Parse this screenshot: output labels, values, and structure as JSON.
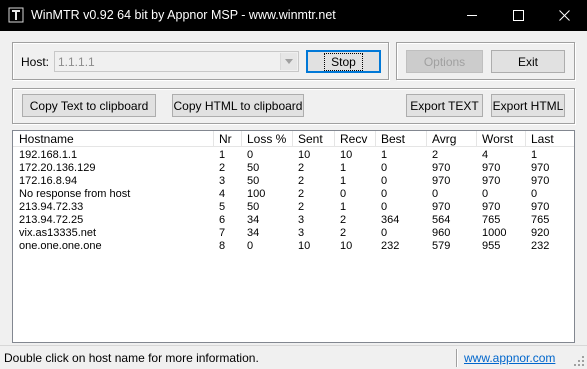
{
  "window": {
    "title": "WinMTR v0.92 64 bit by Appnor MSP - www.winmtr.net",
    "icon": "winmtr-app-icon",
    "controls": {
      "minimize": "minimize-icon",
      "maximize": "maximize-icon",
      "close": "close-icon"
    }
  },
  "host": {
    "label": "Host:",
    "value": "1.1.1.1"
  },
  "buttons": {
    "stop": "Stop",
    "options": "Options",
    "exit": "Exit",
    "copy_text": "Copy Text to clipboard",
    "copy_html": "Copy HTML to clipboard",
    "export_text": "Export TEXT",
    "export_html": "Export HTML"
  },
  "table": {
    "columns": [
      "Hostname",
      "Nr",
      "Loss %",
      "Sent",
      "Recv",
      "Best",
      "Avrg",
      "Worst",
      "Last"
    ],
    "rows": [
      [
        "192.168.1.1",
        "1",
        "0",
        "10",
        "10",
        "1",
        "2",
        "4",
        "1"
      ],
      [
        "172.20.136.129",
        "2",
        "50",
        "2",
        "1",
        "0",
        "970",
        "970",
        "970"
      ],
      [
        "172.16.8.94",
        "3",
        "50",
        "2",
        "1",
        "0",
        "970",
        "970",
        "970"
      ],
      [
        "No response from host",
        "4",
        "100",
        "2",
        "0",
        "0",
        "0",
        "0",
        "0"
      ],
      [
        "213.94.72.33",
        "5",
        "50",
        "2",
        "1",
        "0",
        "970",
        "970",
        "970"
      ],
      [
        "213.94.72.25",
        "6",
        "34",
        "3",
        "2",
        "364",
        "564",
        "765",
        "765"
      ],
      [
        "vix.as13335.net",
        "7",
        "34",
        "3",
        "2",
        "0",
        "960",
        "1000",
        "920"
      ],
      [
        "one.one.one.one",
        "8",
        "0",
        "10",
        "10",
        "232",
        "579",
        "955",
        "232"
      ]
    ]
  },
  "status": {
    "message": "Double click on host name for more information.",
    "link": "www.appnor.com"
  }
}
